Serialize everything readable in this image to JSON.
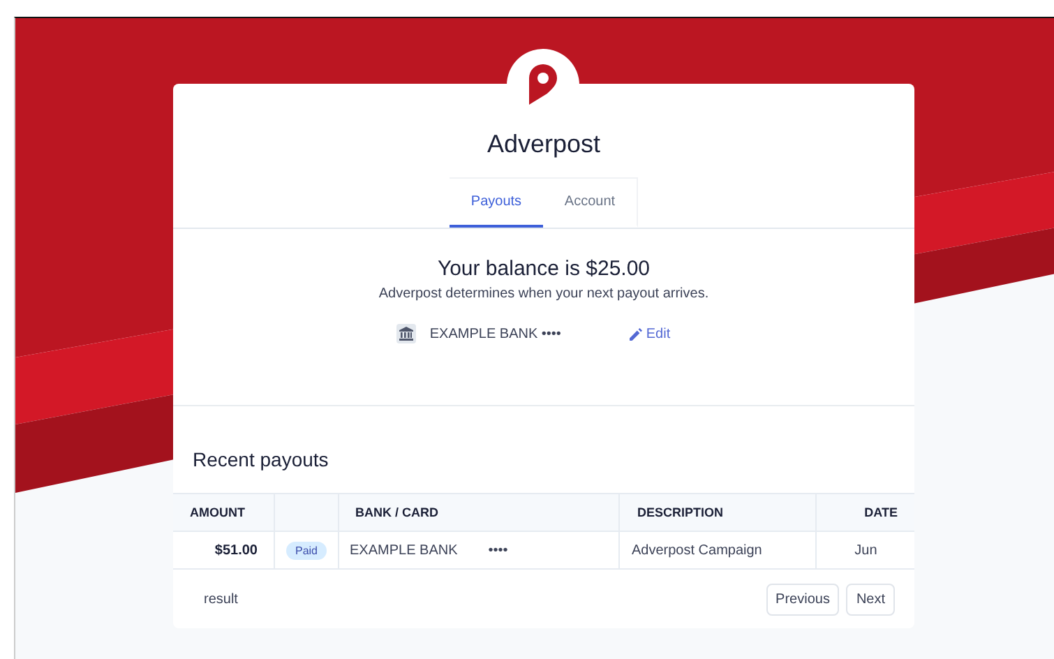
{
  "brand": {
    "name": "Adverpost"
  },
  "tabs": [
    {
      "label": "Payouts",
      "selected": true
    },
    {
      "label": "Account",
      "selected": false
    }
  ],
  "balance": {
    "title": "Your balance is $25.00",
    "note": "Adverpost determines when your next payout arrives.",
    "bank": "EXAMPLE BANK ••••",
    "edit": "Edit"
  },
  "payouts": {
    "title": "Recent payouts",
    "columns": [
      "AMOUNT",
      "",
      "BANK / CARD",
      "DESCRIPTION",
      "DATE"
    ],
    "rows": [
      {
        "amount": "$51.00",
        "status": "Paid",
        "bank": "EXAMPLE BANK",
        "mask": "••••",
        "description": "Adverpost Campaign",
        "date": "Jun"
      }
    ],
    "result": "result",
    "buttons": [
      "Previous",
      "Next"
    ]
  }
}
